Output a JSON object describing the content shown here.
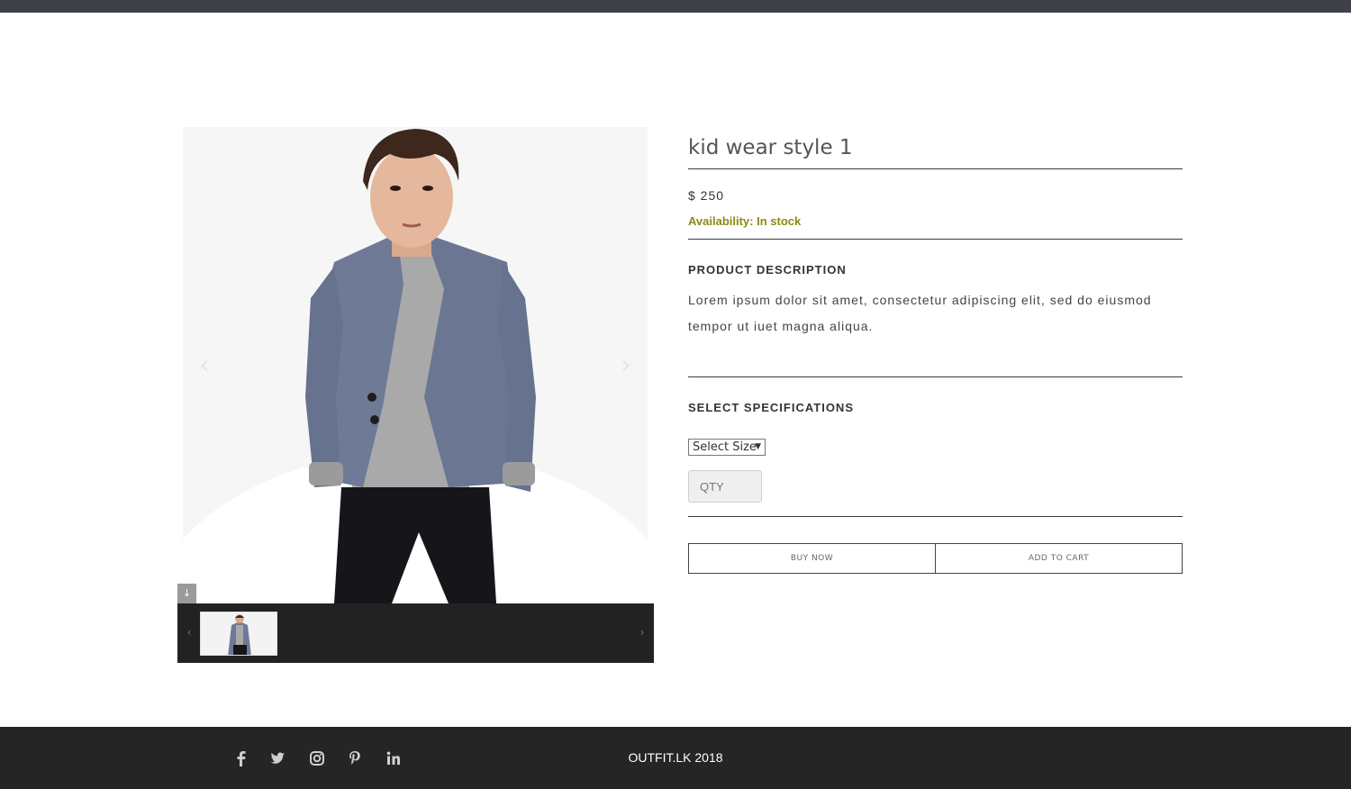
{
  "product": {
    "title": "kid wear style 1",
    "price": "$ 250",
    "availability": "Availability: In stock",
    "description_heading": "PRODUCT DESCRIPTION",
    "description": "Lorem ipsum dolor sit amet, consectetur adipiscing elit, sed do eiusmod tempor ut iuet magna aliqua.",
    "spec_heading": "SELECT SPECIFICATIONS",
    "size_select": {
      "selected": "Select Size"
    },
    "qty_placeholder": "QTY",
    "buy_now_label": "BUY NOW",
    "add_to_cart_label": "ADD TO CART"
  },
  "gallery": {
    "prev_icon": "chevron-left-icon",
    "next_icon": "chevron-right-icon",
    "zoom_icon": "arrow-down-icon",
    "thumb_prev_icon": "chevron-left-icon",
    "thumb_next_icon": "chevron-right-icon"
  },
  "footer": {
    "social_icons": [
      "facebook-icon",
      "twitter-icon",
      "instagram-icon",
      "pinterest-icon",
      "linkedin-icon"
    ],
    "copyright": "OUTFIT.LK 2018"
  },
  "colors": {
    "topbar": "#3f4149",
    "footer": "#252525",
    "availability": "#8c8a12",
    "thumb_strip": "#222222"
  }
}
